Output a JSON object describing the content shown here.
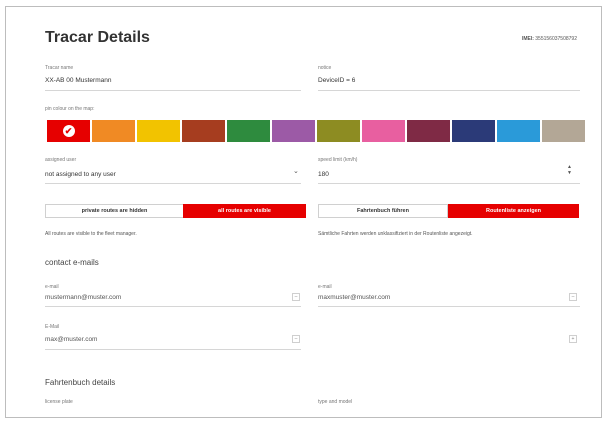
{
  "header": {
    "title": "Tracar Details",
    "imei_label": "IMEI:",
    "imei_value": "355156037508792"
  },
  "fields": {
    "tracar_name": {
      "label": "Tracar name",
      "value": "XX-AB 00 Mustermann"
    },
    "notice": {
      "label": "notice",
      "value": "DeviceID = 6"
    },
    "pin_colour": {
      "label": "pin colour on the map:"
    },
    "assigned_user": {
      "label": "assigned user",
      "value": "not assigned to any user"
    },
    "speed_limit": {
      "label": "speed limit (km/h)",
      "value": "180"
    }
  },
  "colors": [
    {
      "hex": "#e60000",
      "selected": true
    },
    {
      "hex": "#f08a24",
      "selected": false
    },
    {
      "hex": "#f2c300",
      "selected": false
    },
    {
      "hex": "#a63d1f",
      "selected": false
    },
    {
      "hex": "#2e8b3e",
      "selected": false
    },
    {
      "hex": "#9c5aa6",
      "selected": false
    },
    {
      "hex": "#8d8c22",
      "selected": false
    },
    {
      "hex": "#e85fa0",
      "selected": false
    },
    {
      "hex": "#7f2a45",
      "selected": false
    },
    {
      "hex": "#2b3a78",
      "selected": false
    },
    {
      "hex": "#2a9ad9",
      "selected": false
    },
    {
      "hex": "#b3a796",
      "selected": false
    }
  ],
  "routes_toggle": {
    "hidden_label": "private routes are hidden",
    "visible_label": "all routes are visible",
    "note": "All routes are visible to the fleet manager."
  },
  "logbook_toggle": {
    "fahrtenbuch_label": "Fahrtenbuch führen",
    "routenliste_label": "Routenliste anzeigen",
    "note": "Sämtliche Fahrten werden unklassifiziert in der Routenliste angezeigt."
  },
  "contact": {
    "title": "contact e-mails",
    "emails": [
      {
        "label": "e-mail",
        "value": "mustermann@muster.com",
        "btn": "–"
      },
      {
        "label": "e-mail",
        "value": "maxmuster@muster.com",
        "btn": "–"
      },
      {
        "label": "E-Mail",
        "value": "max@muster.com",
        "btn": "–"
      }
    ],
    "add_btn": "+"
  },
  "fahrtenbuch": {
    "title": "Fahrtenbuch details",
    "license_label": "license plate",
    "type_label": "type and model"
  },
  "icons": {
    "check": "✔",
    "chevron": "⌄",
    "spin_up": "▲",
    "spin_down": "▼"
  }
}
